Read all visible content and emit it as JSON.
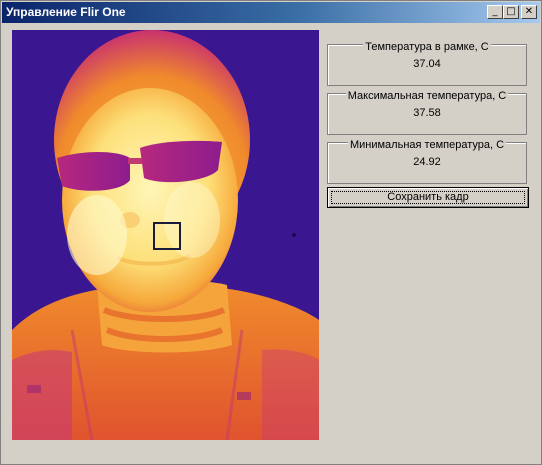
{
  "window": {
    "title": "Управление Flir One",
    "controls": {
      "minimize": "_",
      "maximize": "□",
      "close": "✕"
    }
  },
  "thermal_view": {
    "image_semantic": "thermal-camera-frame-of-person-with-glasses",
    "palette": [
      "#2a0f8a",
      "#7a1aa0",
      "#d83a78",
      "#f07830",
      "#f8b830",
      "#fff4a0"
    ]
  },
  "readouts": {
    "frame_temp": {
      "label": "Температура в рамке, С",
      "value": "37.04"
    },
    "max_temp": {
      "label": "Максимальная температура, С",
      "value": "37.58"
    },
    "min_temp": {
      "label": "Минимальная температура, С",
      "value": "24.92"
    }
  },
  "save_button": {
    "label": "Сохранить кадр"
  }
}
